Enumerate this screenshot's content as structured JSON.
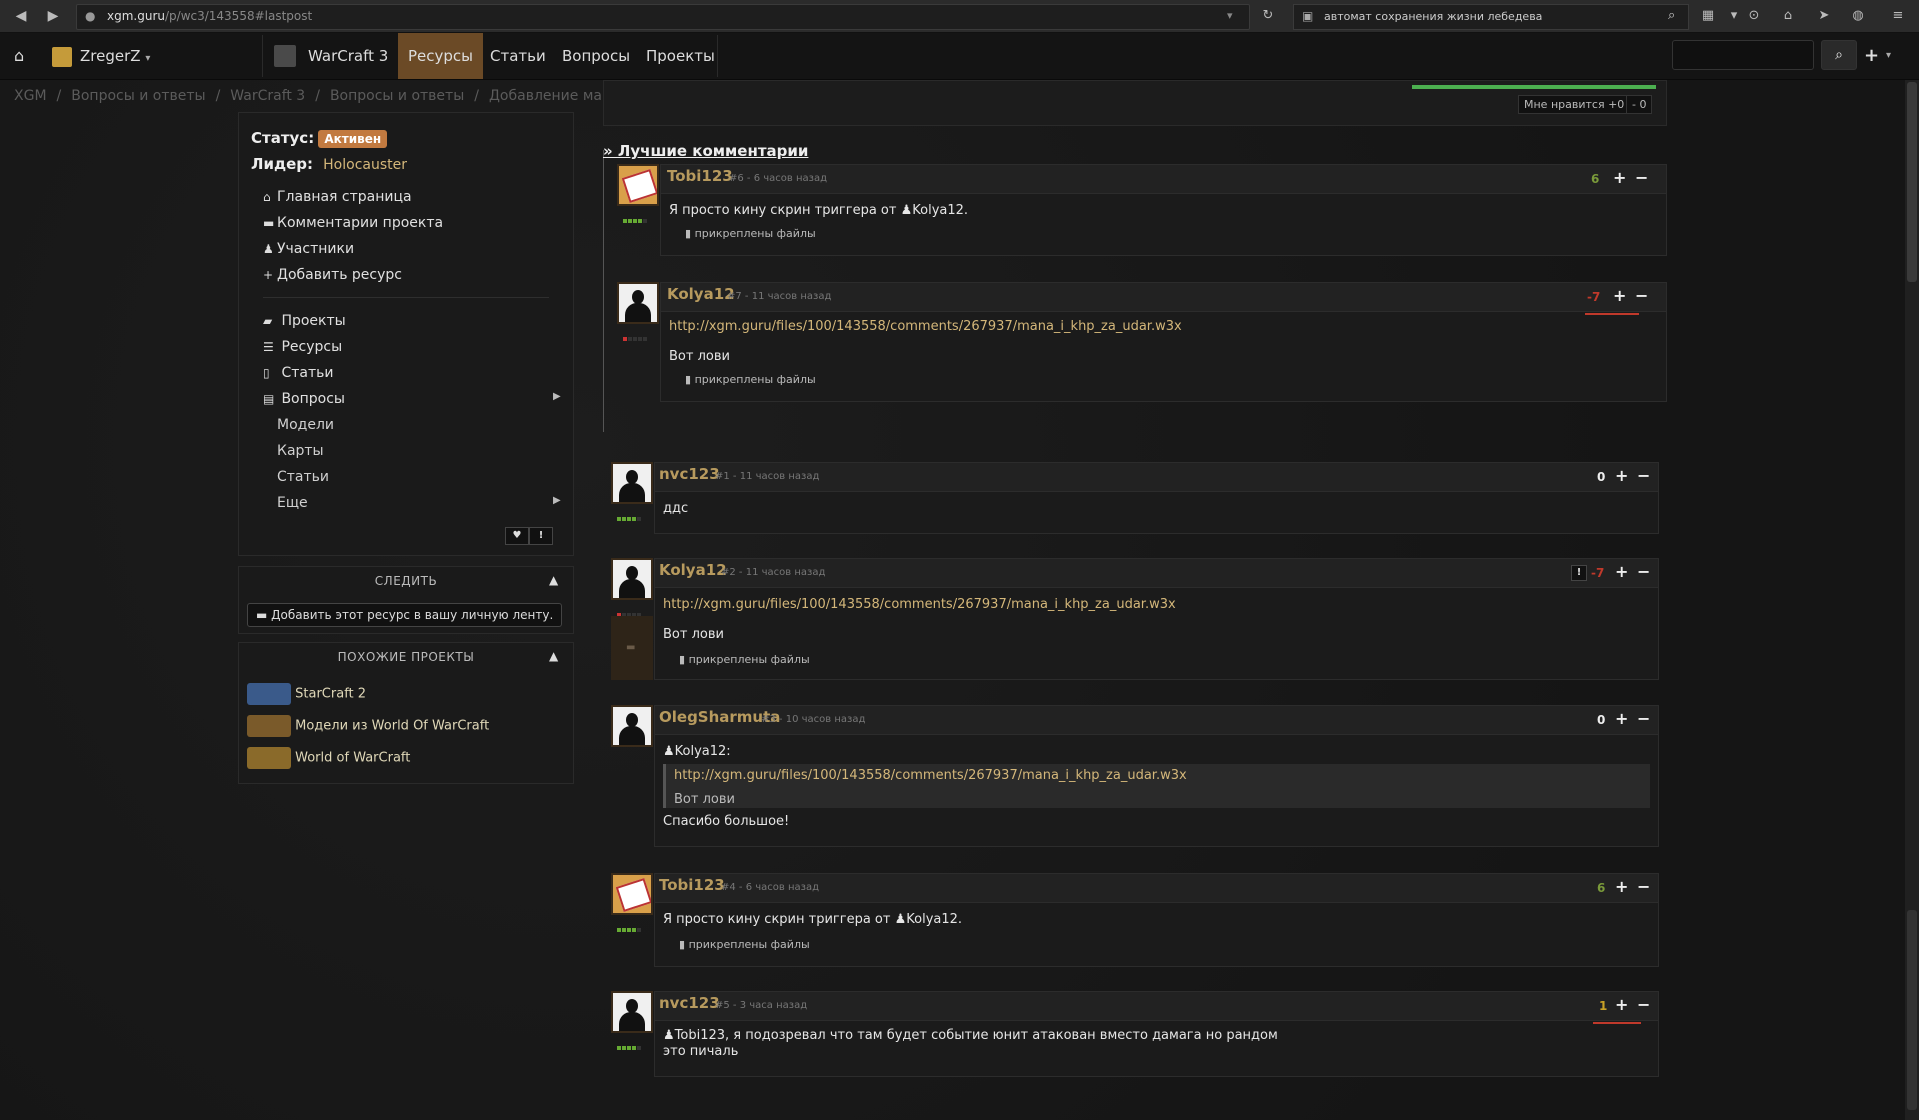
{
  "browser": {
    "url_host": "xgm.guru",
    "url_path": "/p/wc3/143558#lastpost",
    "search_text": "автомат сохранения жизни лебедева"
  },
  "header": {
    "user": "ZregerZ",
    "section": "WarCraft 3",
    "nav": [
      "Ресурсы",
      "Статьи",
      "Вопросы",
      "Проекты"
    ]
  },
  "breadcrumb": [
    "XGM",
    "Вопросы и ответы",
    "WarCraft 3",
    "Вопросы и ответы",
    "Добавление маны герою при нанесении им урона."
  ],
  "sidebar": {
    "status_label": "Статус:",
    "status_value": "Активен",
    "leader_label": "Лидер:",
    "leader_value": "Holocauster",
    "links": [
      "Главная страница",
      "Комментарии проекта",
      "Участники",
      "Добавить ресурс"
    ],
    "sections": [
      "Проекты",
      "Ресурсы",
      "Статьи",
      "Вопросы"
    ],
    "sub": [
      "Модели",
      "Карты",
      "Статьи",
      "Еще"
    ]
  },
  "follow": {
    "title": "СЛЕДИТЬ",
    "button": "Добавить этот ресурс в вашу личную ленту."
  },
  "similar": {
    "title": "ПОХОЖИЕ ПРОЕКТЫ",
    "items": [
      "StarCraft 2",
      "Модели из World Of WarCraft",
      "World of WarCraft"
    ]
  },
  "likes": {
    "like": "Мне нравится +0",
    "minus": "- 0"
  },
  "best": {
    "title": "» Лучшие комментарии",
    "comments": [
      {
        "author": "Tobi123",
        "meta": "#6 - 6 часов назад",
        "score": "6",
        "text_prefix": "Я просто кину скрин триггера от",
        "mention": "Kolya12.",
        "attach": "прикреплены файлы"
      },
      {
        "author": "Kolya12",
        "meta": "#7 - 11 часов назад",
        "score": "-7",
        "link": "http://xgm.guru/files/100/143558/comments/267937/mana_i_khp_za_udar.w3x",
        "text": "Вот лови",
        "attach": "прикреплены файлы"
      }
    ]
  },
  "comments": [
    {
      "author": "nvc123",
      "meta": "#1 - 11 часов назад",
      "score": "0",
      "text": "ддс"
    },
    {
      "author": "Kolya12",
      "meta": "#2 - 11 часов назад",
      "score": "-7",
      "flag": "!",
      "link": "http://xgm.guru/files/100/143558/comments/267937/mana_i_khp_za_udar.w3x",
      "text": "Вот лови",
      "attach": "прикреплены файлы"
    },
    {
      "author": "OlegSharmuta",
      "meta": "#3 - 10 часов назад",
      "score": "0",
      "quote_author": "Kolya12:",
      "quote_link": "http://xgm.guru/files/100/143558/comments/267937/mana_i_khp_za_udar.w3x",
      "quote_text": "Вот лови",
      "text": "Спасибо большое!"
    },
    {
      "author": "Tobi123",
      "meta": "#4 - 6 часов назад",
      "score": "6",
      "text_prefix": "Я просто кину скрин триггера от",
      "mention": "Kolya12.",
      "attach": "прикреплены файлы"
    },
    {
      "author": "nvc123",
      "meta": "#5 - 3 часа назад",
      "score": "1",
      "mention": "Tobi123,",
      "text_line1": "я подозревал что там будет событие юнит атакован вместо дамага но рандом",
      "text_line2": "это пичаль"
    }
  ],
  "colors": {
    "accent": "#6b4a26",
    "author": "#b79a5e",
    "positive": "#7a9a3a",
    "negative": "#c0392b"
  }
}
